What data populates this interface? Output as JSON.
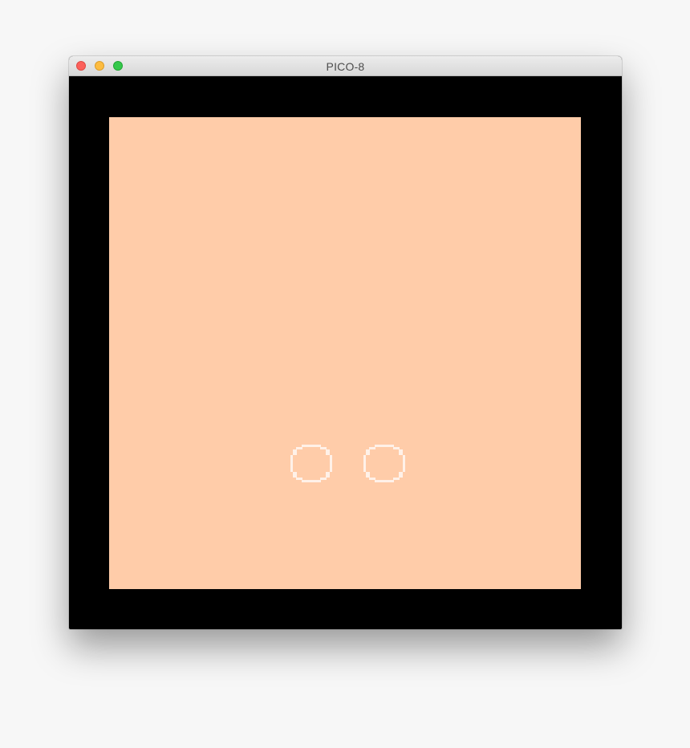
{
  "window": {
    "title": "PICO-8"
  },
  "screen": {
    "background_color": "#ffcca9",
    "border_color": "#000000",
    "sprite_color": "#fff1e8",
    "objects": [
      {
        "name": "left-circle",
        "shape": "ring"
      },
      {
        "name": "right-circle",
        "shape": "ring"
      }
    ]
  },
  "controls": [
    "close",
    "minimize",
    "maximize"
  ]
}
